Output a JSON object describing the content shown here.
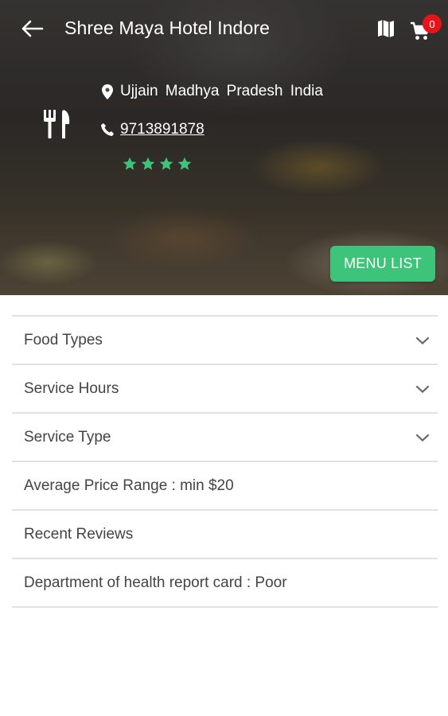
{
  "header": {
    "title": "Shree Maya Hotel Indore",
    "cart_count": "0",
    "icons": [
      "arrow-left-icon",
      "map-icon",
      "cart-icon"
    ]
  },
  "restaurant": {
    "location": "Ujjain  Madhya Pradesh  India",
    "phone": "9713891878",
    "rating": 4,
    "rating_max": 4,
    "star_color": "#3ec47a"
  },
  "actions": {
    "menu_list_label": "MENU LIST",
    "accent_color": "#3ec47a"
  },
  "details": {
    "items": [
      {
        "label": "Food Types",
        "expandable": true
      },
      {
        "label": "Service Hours",
        "expandable": true
      },
      {
        "label": "Service Type",
        "expandable": true
      },
      {
        "label": "Average Price Range : min $20",
        "expandable": false
      },
      {
        "label": "Recent Reviews",
        "expandable": false
      },
      {
        "label": "Department of health report card : Poor",
        "expandable": false
      }
    ]
  }
}
